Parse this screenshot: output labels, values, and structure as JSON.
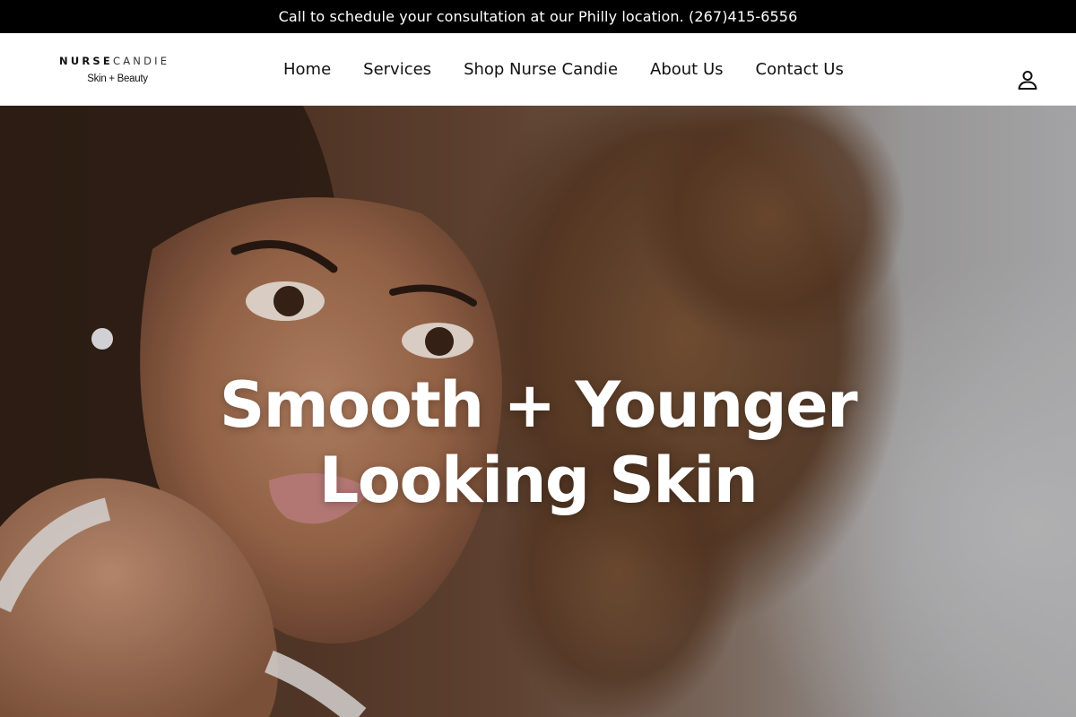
{
  "announcement": {
    "text": "Call to schedule your consultation at our Philly location. (267)415-6556"
  },
  "header": {
    "logo": {
      "word_bold": "NURSE",
      "word_light": "CANDIE",
      "tagline": "Skin + Beauty"
    },
    "nav": [
      {
        "label": "Home"
      },
      {
        "label": "Services"
      },
      {
        "label": "Shop Nurse Candie"
      },
      {
        "label": "About Us"
      },
      {
        "label": "Contact Us"
      }
    ],
    "account_icon": "account-user-icon"
  },
  "hero": {
    "title": "Smooth + Younger Looking Skin",
    "background_image": "hero-portrait-photo"
  },
  "colors": {
    "announcement_bg": "#000000",
    "announcement_text": "#ffffff",
    "header_bg": "#ffffff",
    "nav_text": "#111111",
    "hero_title": "#ffffff"
  }
}
